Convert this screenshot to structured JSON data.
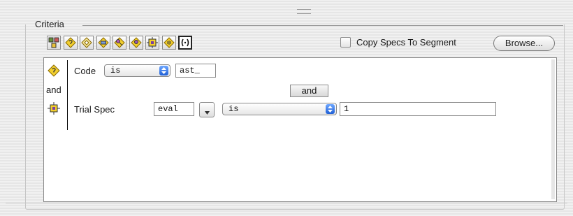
{
  "window": {
    "resize_grip_icon": "drag-grip-icon"
  },
  "criteria": {
    "title": "Criteria",
    "toolbar": [
      {
        "name": "toolbar-button-1",
        "icon": "multi-spec-icon"
      },
      {
        "name": "toolbar-button-2",
        "icon": "code-spec-icon"
      },
      {
        "name": "toolbar-button-3",
        "icon": "diamond-spec-icon"
      },
      {
        "name": "toolbar-button-4",
        "icon": "grid-diamond-icon"
      },
      {
        "name": "toolbar-button-5",
        "icon": "key-diamond-icon"
      },
      {
        "name": "toolbar-button-6",
        "icon": "pin-diamond-icon"
      },
      {
        "name": "toolbar-button-7",
        "icon": "trial-spec-icon"
      },
      {
        "name": "toolbar-button-8",
        "icon": "bars-diamond-icon"
      },
      {
        "name": "toolbar-button-9",
        "icon": "bracket-group-icon"
      }
    ],
    "copy_specs_label": "Copy Specs To Segment",
    "copy_specs_checked": false,
    "browse_label": "Browse..."
  },
  "rows": {
    "row1": {
      "icon": "code-spec-icon",
      "label": "Code",
      "operator": "is",
      "value": "ast_"
    },
    "connector": "and",
    "and_button": "and",
    "row2": {
      "icon": "trial-spec-icon",
      "label": "Trial Spec",
      "spec_field": "eval",
      "operator": "is",
      "value": "1"
    }
  },
  "colors": {
    "diamond_yellow": "#f2cf2e",
    "diamond_outline": "#8a6a00",
    "popup_arrow_blue": "#2f6fe0"
  }
}
